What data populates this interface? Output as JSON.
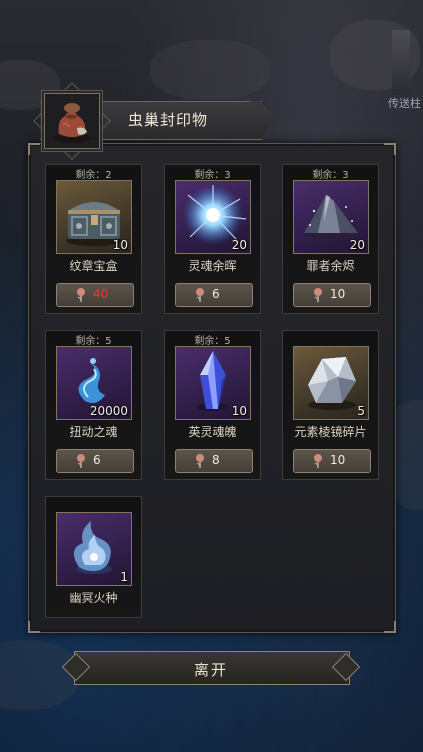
{
  "background": {
    "portal_label": "传送柱"
  },
  "header": {
    "title": "虫巢封印物"
  },
  "items": [
    {
      "remain": "剩余：2",
      "qty": "10",
      "name": "纹章宝盒",
      "cost": "40",
      "cost_insufficient": true,
      "rarity": "gold",
      "icon": "ornate-chest-icon"
    },
    {
      "remain": "剩余：3",
      "qty": "20",
      "name": "灵魂余晖",
      "cost": "6",
      "cost_insufficient": false,
      "rarity": "purple",
      "icon": "soul-glow-icon"
    },
    {
      "remain": "剩余：3",
      "qty": "20",
      "name": "罪者余烬",
      "cost": "10",
      "cost_insufficient": false,
      "rarity": "purple",
      "icon": "ember-pile-icon"
    },
    {
      "remain": "剩余：5",
      "qty": "20000",
      "name": "扭动之魂",
      "cost": "6",
      "cost_insufficient": false,
      "rarity": "purple",
      "icon": "twisting-soul-icon"
    },
    {
      "remain": "剩余：5",
      "qty": "10",
      "name": "英灵魂魄",
      "cost": "8",
      "cost_insufficient": false,
      "rarity": "purple",
      "icon": "blue-crystal-icon"
    },
    {
      "remain": "",
      "qty": "5",
      "name": "元素棱镜碎片",
      "cost": "10",
      "cost_insufficient": false,
      "rarity": "gold",
      "icon": "prism-shard-icon"
    },
    {
      "remain": "",
      "qty": "1",
      "name": "幽冥火种",
      "cost": "",
      "cost_insufficient": false,
      "rarity": "purple",
      "icon": "netherflame-icon"
    }
  ],
  "currency_icon": "seed-token-icon",
  "footer": {
    "leave_label": "离开"
  }
}
